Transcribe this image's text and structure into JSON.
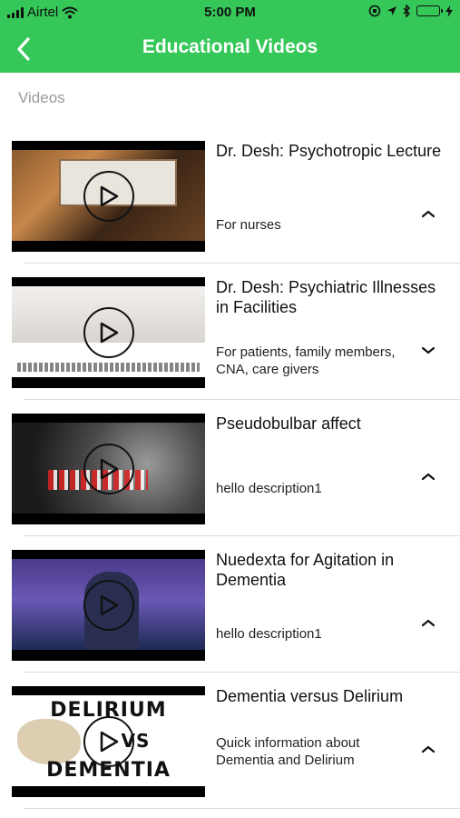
{
  "status_bar": {
    "carrier": "Airtel",
    "time": "5:00 PM"
  },
  "header": {
    "title": "Educational Videos",
    "back_icon": "chevron-left-icon",
    "color": "#35c758"
  },
  "section": {
    "label": "Videos"
  },
  "videos": [
    {
      "title": "Dr. Desh: Psychotropic Lecture",
      "description": "For nurses",
      "expanded": true
    },
    {
      "title": "Dr. Desh: Psychiatric Illnesses in Facilities",
      "description": "For patients, family members, CNA, care givers",
      "expanded": false
    },
    {
      "title": "Pseudobulbar affect",
      "description": "hello description1",
      "expanded": true
    },
    {
      "title": "Nuedexta for Agitation in Dementia",
      "description": "hello description1",
      "expanded": true
    },
    {
      "title": "Dementia versus Delirium",
      "description": "Quick information about Dementia and Delirium",
      "expanded": true,
      "thumbnail_text": {
        "top": "DELIRIUM",
        "middle": "VS",
        "bottom": "DEMENTIA"
      }
    }
  ]
}
